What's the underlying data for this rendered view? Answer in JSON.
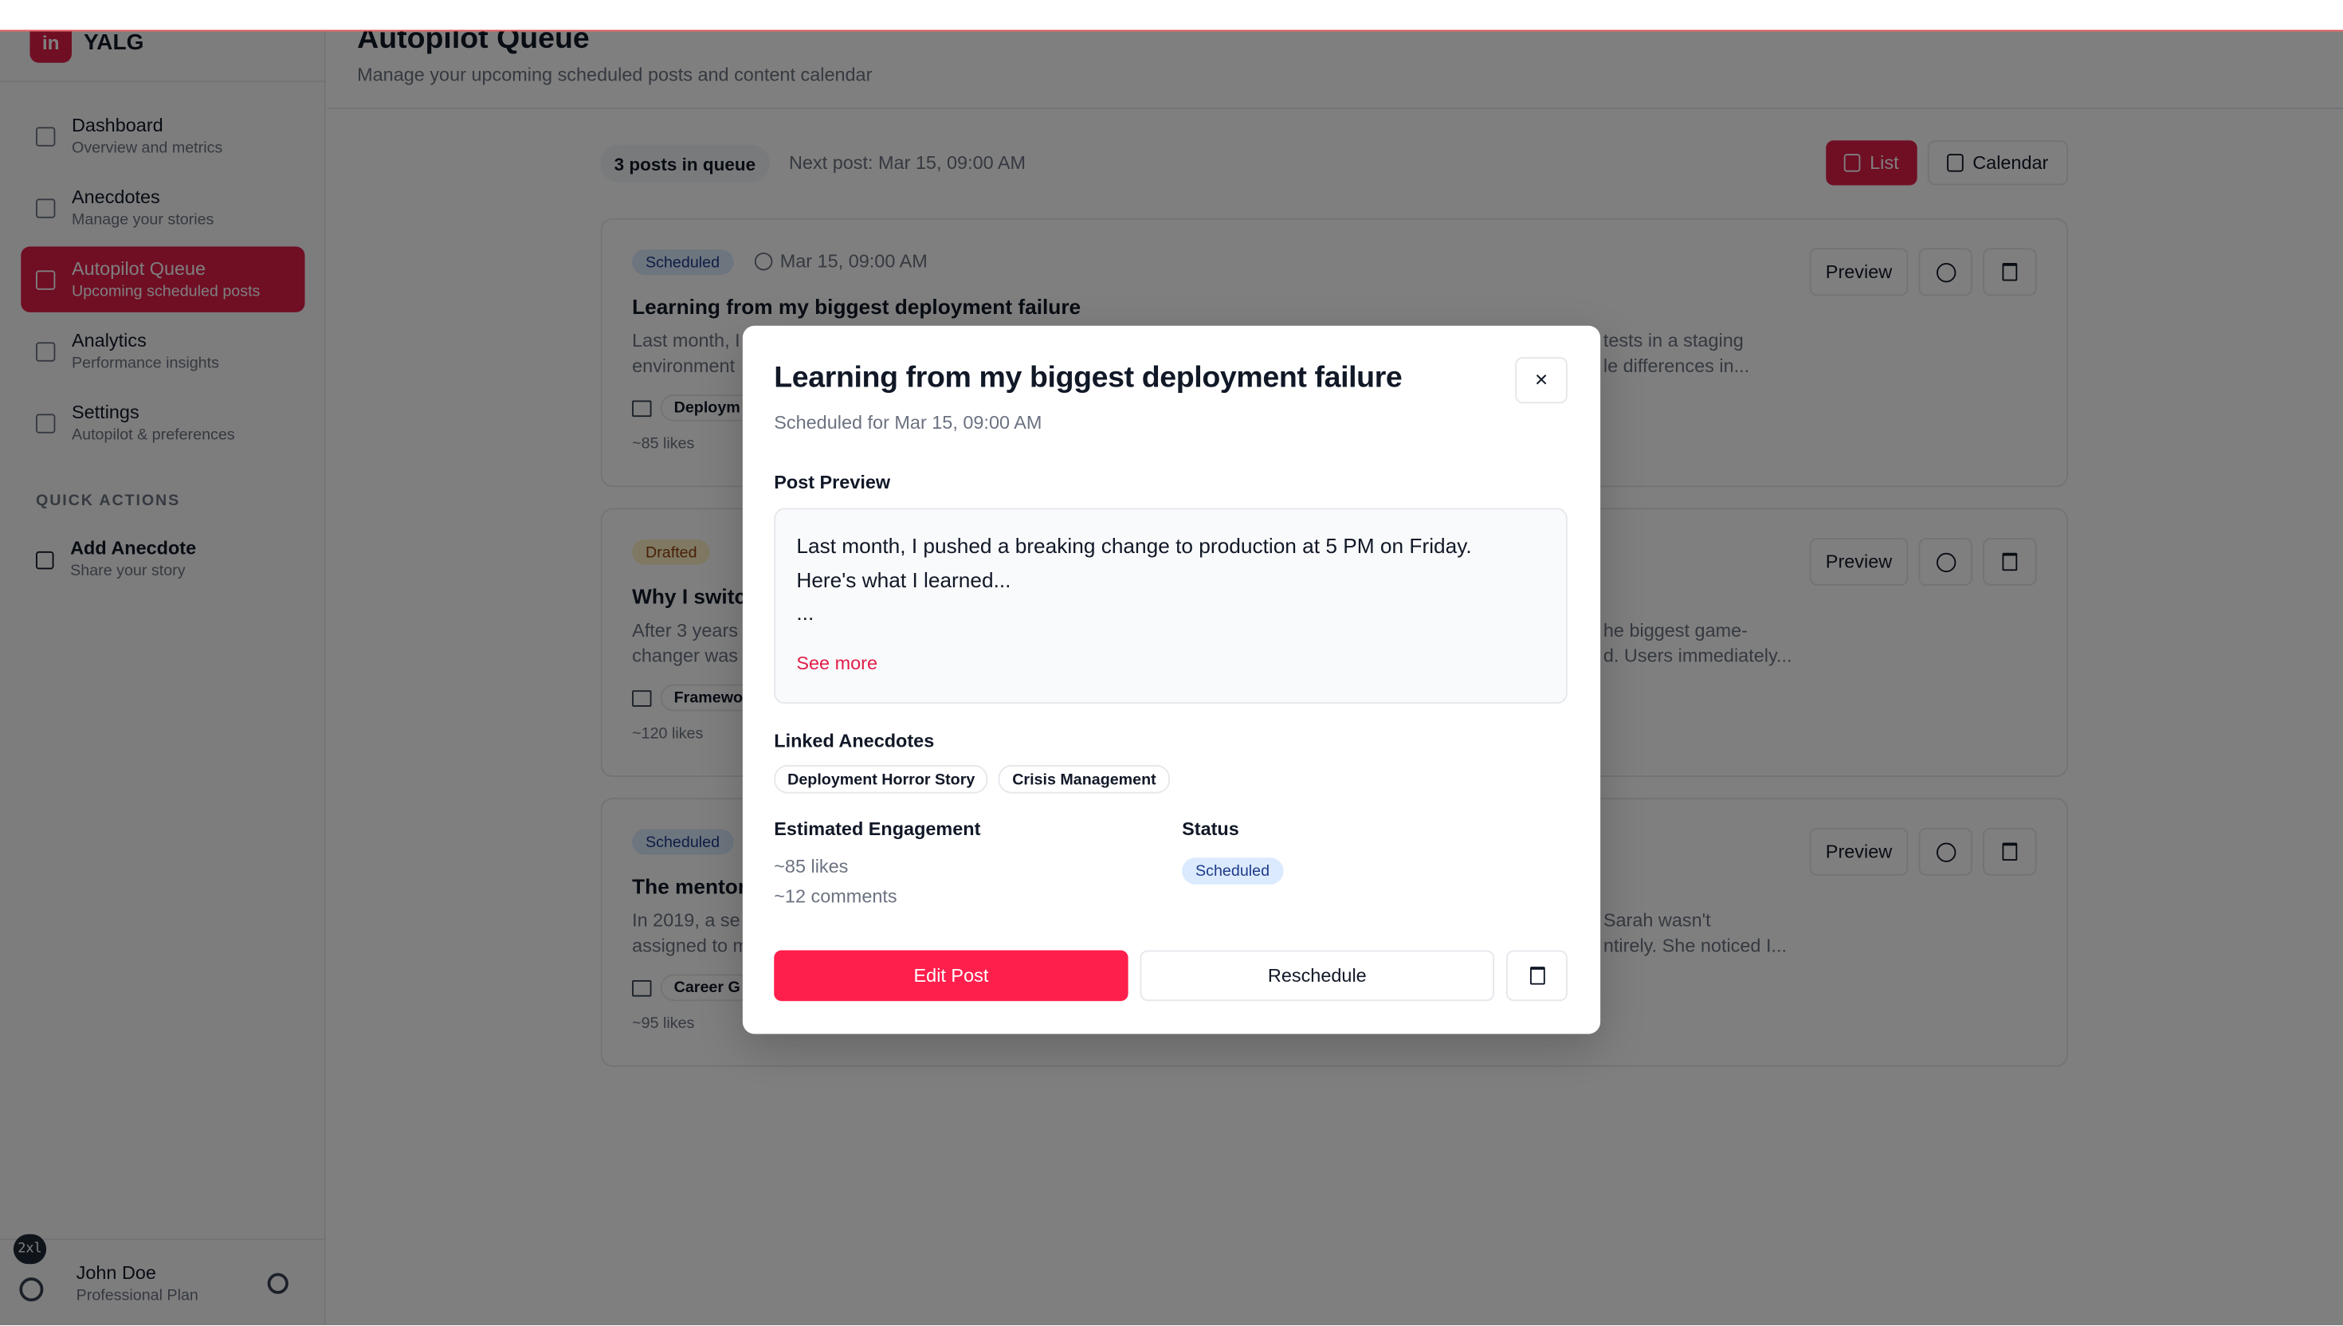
{
  "app": {
    "name": "YALG",
    "logo_glyph": "in"
  },
  "sidebar": {
    "items": [
      {
        "title": "Dashboard",
        "sub": "Overview and metrics",
        "icon": "home-icon"
      },
      {
        "title": "Anecdotes",
        "sub": "Manage your stories",
        "icon": "book-icon"
      },
      {
        "title": "Autopilot Queue",
        "sub": "Upcoming scheduled posts",
        "icon": "calendar-icon",
        "active": true
      },
      {
        "title": "Analytics",
        "sub": "Performance insights",
        "icon": "chart-icon"
      },
      {
        "title": "Settings",
        "sub": "Autopilot & preferences",
        "icon": "gear-icon"
      }
    ],
    "quick_actions_title": "QUICK ACTIONS",
    "quick_action": {
      "title": "Add Anecdote",
      "sub": "Share your story"
    },
    "user": {
      "name": "John Doe",
      "plan": "Professional Plan"
    },
    "breakpoint_badge": "2xl"
  },
  "header": {
    "title": "Autopilot Queue",
    "subtitle": "Manage your upcoming scheduled posts and content calendar"
  },
  "toolbar": {
    "queue_count": "3 posts in queue",
    "next_post": "Next post: Mar 15, 09:00 AM",
    "list_label": "List",
    "calendar_label": "Calendar"
  },
  "cards": [
    {
      "status": "Scheduled",
      "date": "Mar 15, 09:00 AM",
      "title": "Learning from my biggest deployment failure",
      "excerpt_left": "Last month, I",
      "excerpt_left2": "environment",
      "excerpt_right": "tests in a staging",
      "excerpt_right2": "le differences in...",
      "tag": "Deploym",
      "stats": "~85 likes"
    },
    {
      "status": "Drafted",
      "title": "Why I switc",
      "excerpt_left": "After 3 years",
      "excerpt_left2": "changer was",
      "excerpt_right": "he biggest game-",
      "excerpt_right2": "d. Users immediately...",
      "tag": "Framewo",
      "stats": "~120 likes"
    },
    {
      "status": "Scheduled",
      "title": "The mentor",
      "excerpt_left": "In 2019, a se",
      "excerpt_left2": "assigned to m",
      "excerpt_right": "Sarah wasn't",
      "excerpt_right2": "ntirely. She noticed I...",
      "tag": "Career G",
      "stats": "~95 likes"
    }
  ],
  "card_actions": {
    "preview_label": "Preview"
  },
  "modal": {
    "title": "Learning from my biggest deployment failure",
    "subtitle": "Scheduled for Mar 15, 09:00 AM",
    "close_glyph": "×",
    "preview_label": "Post Preview",
    "preview_text": "Last month, I pushed a breaking change to production at 5 PM on Friday.\nHere's what I learned...\n...",
    "see_more": "See more",
    "linked_label": "Linked Anecdotes",
    "linked_tags": [
      "Deployment Horror Story",
      "Crisis Management"
    ],
    "engagement_label": "Estimated Engagement",
    "likes": "~85 likes",
    "comments": "~12 comments",
    "status_label": "Status",
    "status_value": "Scheduled",
    "edit_label": "Edit Post",
    "reschedule_label": "Reschedule"
  },
  "colors": {
    "accent": "#e11d48",
    "edit_button": "#ff1f4d",
    "overlay": "rgba(0,0,0,0.5)"
  }
}
